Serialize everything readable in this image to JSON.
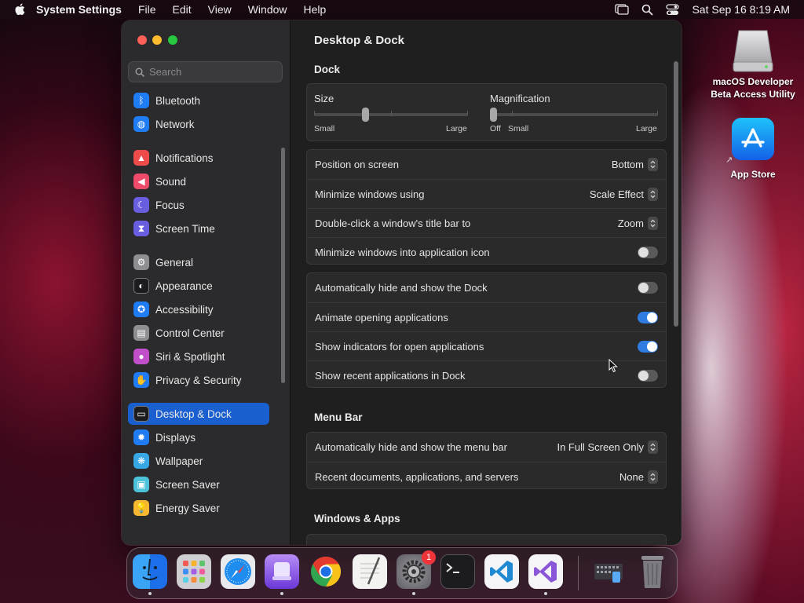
{
  "menubar": {
    "app_name": "System Settings",
    "menus": [
      "File",
      "Edit",
      "View",
      "Window",
      "Help"
    ],
    "clock": "Sat Sep 16  8:19 AM"
  },
  "window": {
    "search_placeholder": "Search",
    "sidebar": {
      "items": [
        {
          "label": "Bluetooth",
          "icon": "bluetooth-icon",
          "color": "#1f7cf2"
        },
        {
          "label": "Network",
          "icon": "globe-icon",
          "color": "#1f7cf2"
        },
        {
          "label": "Notifications",
          "icon": "bell-icon",
          "color": "#ee4b4b"
        },
        {
          "label": "Sound",
          "icon": "speaker-icon",
          "color": "#ee4b6b"
        },
        {
          "label": "Focus",
          "icon": "moon-icon",
          "color": "#6a5ee0"
        },
        {
          "label": "Screen Time",
          "icon": "hourglass-icon",
          "color": "#6a5ee0"
        },
        {
          "label": "General",
          "icon": "gear-icon",
          "color": "#8e8e93"
        },
        {
          "label": "Appearance",
          "icon": "appearance-icon",
          "color": "#1c1c1e"
        },
        {
          "label": "Accessibility",
          "icon": "accessibility-icon",
          "color": "#1f7cf2"
        },
        {
          "label": "Control Center",
          "icon": "control-center-icon",
          "color": "#8e8e93"
        },
        {
          "label": "Siri & Spotlight",
          "icon": "siri-icon",
          "color": "#c04fc9"
        },
        {
          "label": "Privacy & Security",
          "icon": "hand-icon",
          "color": "#1f7cf2"
        },
        {
          "label": "Desktop & Dock",
          "icon": "dock-icon",
          "color": "#1c1c1e",
          "active": true
        },
        {
          "label": "Displays",
          "icon": "sun-icon",
          "color": "#1f7cf2"
        },
        {
          "label": "Wallpaper",
          "icon": "wallpaper-icon",
          "color": "#36a8e6"
        },
        {
          "label": "Screen Saver",
          "icon": "screensaver-icon",
          "color": "#4cc3d9"
        },
        {
          "label": "Energy Saver",
          "icon": "bulb-icon",
          "color": "#f5b82e"
        }
      ]
    },
    "content": {
      "title": "Desktop & Dock",
      "dock_section": "Dock",
      "size": {
        "label": "Size",
        "min": "Small",
        "max": "Large",
        "value": 0.33
      },
      "magnification": {
        "label": "Magnification",
        "off": "Off",
        "min": "Small",
        "max": "Large",
        "value": 0.0
      },
      "rows1": [
        {
          "label": "Position on screen",
          "value": "Bottom"
        },
        {
          "label": "Minimize windows using",
          "value": "Scale Effect"
        },
        {
          "label": "Double-click a window's title bar to",
          "value": "Zoom"
        },
        {
          "label": "Minimize windows into application icon",
          "toggle": false
        }
      ],
      "rows2": [
        {
          "label": "Automatically hide and show the Dock",
          "toggle": false
        },
        {
          "label": "Animate opening applications",
          "toggle": true
        },
        {
          "label": "Show indicators for open applications",
          "toggle": true
        },
        {
          "label": "Show recent applications in Dock",
          "toggle": false
        }
      ],
      "menubar_section": "Menu Bar",
      "rows3": [
        {
          "label": "Automatically hide and show the menu bar",
          "value": "In Full Screen Only"
        },
        {
          "label": "Recent documents, applications, and servers",
          "value": "None"
        }
      ],
      "windows_section": "Windows & Apps"
    }
  },
  "desktop": {
    "icon1_line1": "macOS Developer",
    "icon1_line2": "Beta Access Utility",
    "icon2": "App Store"
  },
  "dock": {
    "apps": [
      "Finder",
      "Launchpad",
      "Safari",
      "Simulator",
      "Chrome",
      "TextEdit",
      "System Settings",
      "Terminal",
      "VS Code",
      "Visual Studio",
      "Downloads",
      "Trash"
    ],
    "settings_badge": "1"
  }
}
